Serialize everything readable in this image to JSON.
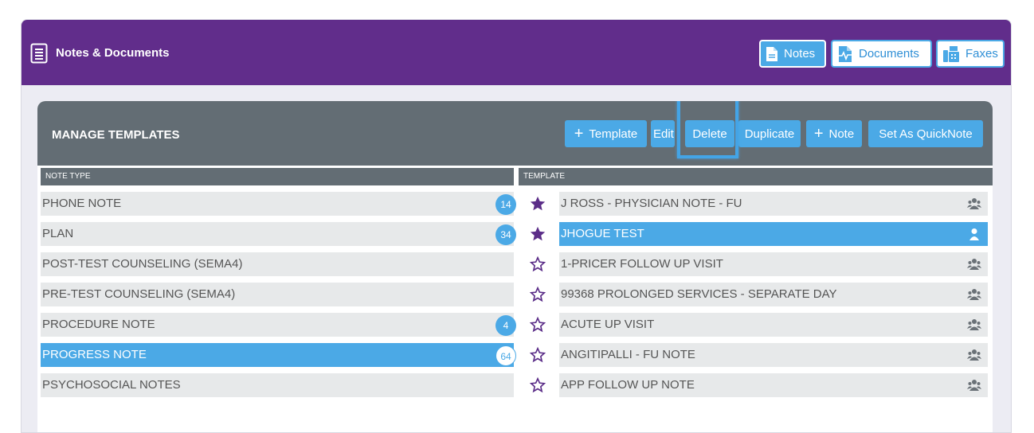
{
  "header": {
    "title": "Notes & Documents",
    "tabs": [
      {
        "label": "Notes",
        "icon": "note-file-icon"
      },
      {
        "label": "Documents",
        "icon": "document-pulse-icon"
      },
      {
        "label": "Faxes",
        "icon": "fax-icon"
      }
    ]
  },
  "manage": {
    "title": "MANAGE TEMPLATES",
    "buttons": [
      {
        "label": "Template",
        "plus": "+"
      },
      {
        "label": "Edit"
      },
      {
        "label": "Delete"
      },
      {
        "label": "Duplicate"
      },
      {
        "label": "Note",
        "plus": "+"
      },
      {
        "label": "Set As QuickNote"
      }
    ]
  },
  "note_types": {
    "header": "NOTE TYPE",
    "items": [
      {
        "label": "PHONE NOTE",
        "count": "14",
        "selected": false
      },
      {
        "label": "PLAN",
        "count": "34",
        "selected": false
      },
      {
        "label": "POST-TEST COUNSELING (SEMA4)",
        "count": "",
        "selected": false
      },
      {
        "label": "PRE-TEST COUNSELING (SEMA4)",
        "count": "",
        "selected": false
      },
      {
        "label": "PROCEDURE NOTE",
        "count": "4",
        "selected": false
      },
      {
        "label": "PROGRESS NOTE",
        "count": "64",
        "selected": true
      },
      {
        "label": "PSYCHOSOCIAL NOTES",
        "count": "",
        "selected": false
      }
    ]
  },
  "templates": {
    "header": "TEMPLATE",
    "items": [
      {
        "label": "J ROSS - PHYSICIAN NOTE - FU",
        "favorite": true,
        "shared": true,
        "selected": false
      },
      {
        "label": "JHOGUE TEST",
        "favorite": true,
        "shared": false,
        "selected": true
      },
      {
        "label": "1-PRICER FOLLOW UP VISIT",
        "favorite": false,
        "shared": true,
        "selected": false
      },
      {
        "label": "99368 PROLONGED SERVICES - SEPARATE DAY",
        "favorite": false,
        "shared": true,
        "selected": false
      },
      {
        "label": "ACUTE UP VISIT",
        "favorite": false,
        "shared": true,
        "selected": false
      },
      {
        "label": "ANGITIPALLI - FU NOTE",
        "favorite": false,
        "shared": true,
        "selected": false
      },
      {
        "label": "APP FOLLOW UP NOTE",
        "favorite": false,
        "shared": true,
        "selected": false
      }
    ]
  },
  "colors": {
    "purple": "#612d8b",
    "blue": "#4ba9e6",
    "slate": "#636d74",
    "star": "#5b2d88"
  }
}
